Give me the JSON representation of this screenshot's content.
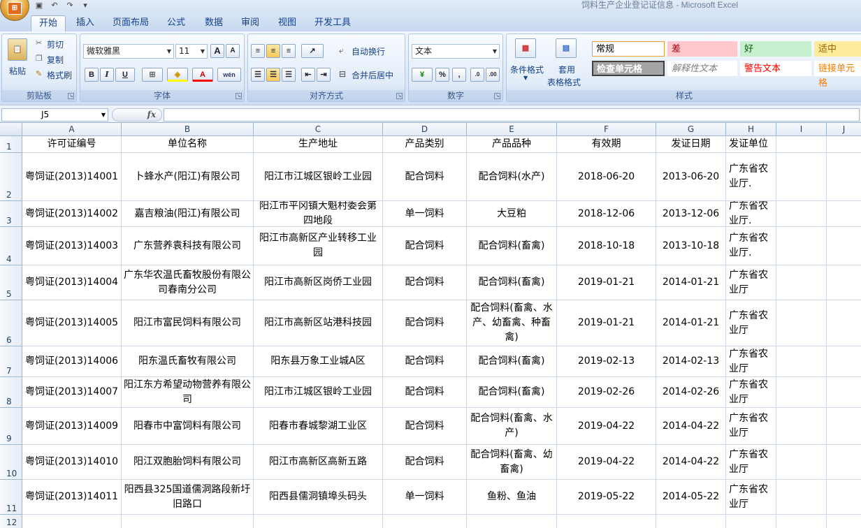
{
  "window": {
    "title": "饲料生产企业登记证信息 - Microsoft Excel"
  },
  "tabs": [
    "开始",
    "插入",
    "页面布局",
    "公式",
    "数据",
    "审阅",
    "视图",
    "开发工具"
  ],
  "ribbon": {
    "clipboard": {
      "paste": "粘贴",
      "cut": "剪切",
      "copy": "复制",
      "format_painter": "格式刷",
      "label": "剪贴板"
    },
    "font": {
      "name": "微软雅黑",
      "size": "11",
      "bold": "B",
      "italic": "I",
      "underline": "U",
      "grow": "A",
      "shrink": "A",
      "color": "A",
      "label": "字体"
    },
    "alignment": {
      "wrap": "自动换行",
      "merge": "合并后居中",
      "label": "对齐方式"
    },
    "number": {
      "format": "文本",
      "percent": "%",
      "comma": ",",
      "label": "数字"
    },
    "styles": {
      "conditional": "条件格式",
      "table_line1": "套用",
      "table_line2": "表格格式",
      "label": "样式",
      "cells": [
        {
          "text": "常规",
          "bg": "#ffffff",
          "color": "#000000",
          "border": "#e8a13a"
        },
        {
          "text": "差",
          "bg": "#ffc7ce",
          "color": "#9c0006",
          "border": "#ffc7ce"
        },
        {
          "text": "好",
          "bg": "#c6efce",
          "color": "#006100",
          "border": "#c6efce"
        },
        {
          "text": "适中",
          "bg": "#ffeb9c",
          "color": "#9c6500",
          "border": "#ffeb9c"
        },
        {
          "text": "检查单元格",
          "bg": "#a5a5a5",
          "color": "#ffffff",
          "border": "#3f3f3f"
        },
        {
          "text": "解释性文本",
          "bg": "#ffffff",
          "color": "#7f7f7f",
          "border": "#ffffff"
        },
        {
          "text": "警告文本",
          "bg": "#ffffff",
          "color": "#ff0000",
          "border": "#ffffff"
        },
        {
          "text": "链接单元格",
          "bg": "#ffffff",
          "color": "#fa7d00",
          "border": "#ffffff"
        }
      ]
    }
  },
  "formula_bar": {
    "name_box": "J5",
    "fx": "fx",
    "content": ""
  },
  "columns": [
    "A",
    "B",
    "C",
    "D",
    "E",
    "F",
    "G",
    "H",
    "I",
    "J"
  ],
  "rows": [
    {
      "n": "1",
      "cells": [
        "许可证编号",
        "单位名称",
        "生产地址",
        "产品类别",
        "产品品种",
        "有效期",
        "发证日期",
        "发证单位",
        "",
        ""
      ]
    },
    {
      "n": "2",
      "cells": [
        "粤饲证(2013)14001",
        "卜蜂水产(阳江)有限公司",
        "阳江市江城区银岭工业园",
        "配合饲料",
        "配合饲料(水产)",
        "2018-06-20",
        "2013-06-20",
        "广东省农业厅.",
        "",
        ""
      ]
    },
    {
      "n": "3",
      "cells": [
        "粤饲证(2013)14002",
        "嘉吉粮油(阳江)有限公司",
        "阳江市平冈镇大魁村委会第四地段",
        "单一饲料",
        "大豆粕",
        "2018-12-06",
        "2013-12-06",
        "广东省农业厅.",
        "",
        ""
      ]
    },
    {
      "n": "4",
      "cells": [
        "粤饲证(2013)14003",
        "广东营养袁科技有限公司",
        "阳江市高新区产业转移工业园",
        "配合饲料",
        "配合饲料(畜禽)",
        "2018-10-18",
        "2013-10-18",
        "广东省农业厅.",
        "",
        ""
      ]
    },
    {
      "n": "5",
      "cells": [
        "粤饲证(2013)14004",
        "广东华农温氏畜牧股份有限公司春南分公司",
        "阳江市高新区岗侨工业园",
        "配合饲料",
        "配合饲料(畜禽)",
        "2019-01-21",
        "2014-01-21",
        "广东省农业厅",
        "",
        ""
      ]
    },
    {
      "n": "6",
      "cells": [
        "粤饲证(2013)14005",
        "阳江市富民饲料有限公司",
        "阳江市高新区站港科技园",
        "配合饲料",
        "配合饲料(畜禽、水产、幼畜禽、种畜禽)",
        "2019-01-21",
        "2014-01-21",
        "广东省农业厅",
        "",
        ""
      ]
    },
    {
      "n": "7",
      "cells": [
        "粤饲证(2013)14006",
        "阳东温氏畜牧有限公司",
        "阳东县万象工业城A区",
        "配合饲料",
        "配合饲料(畜禽)",
        "2019-02-13",
        "2014-02-13",
        "广东省农业厅",
        "",
        ""
      ]
    },
    {
      "n": "8",
      "cells": [
        "粤饲证(2013)14007",
        "阳江东方希望动物营养有限公司",
        "阳江市江城区银岭工业园",
        "配合饲料",
        "配合饲料(畜禽)",
        "2019-02-26",
        "2014-02-26",
        "广东省农业厅",
        "",
        ""
      ]
    },
    {
      "n": "9",
      "cells": [
        "粤饲证(2013)14009",
        "阳春市中富饲料有限公司",
        "阳春市春城黎湖工业区",
        "配合饲料",
        "配合饲料(畜禽、水产)",
        "2019-04-22",
        "2014-04-22",
        "广东省农业厅",
        "",
        ""
      ]
    },
    {
      "n": "10",
      "cells": [
        "粤饲证(2013)14010",
        "阳江双胞胎饲料有限公司",
        "阳江市高新区高新五路",
        "配合饲料",
        "配合饲料(畜禽、幼畜禽)",
        "2019-04-22",
        "2014-04-22",
        "广东省农业厅",
        "",
        ""
      ]
    },
    {
      "n": "11",
      "cells": [
        "粤饲证(2013)14011",
        "阳西县325国道儒洞路段新圩旧路口",
        "阳西县儒洞镇埠头码头",
        "单一饲料",
        "鱼粉、鱼油",
        "2019-05-22",
        "2014-05-22",
        "广东省农业厅",
        "",
        ""
      ]
    },
    {
      "n": "12",
      "cells": [
        "",
        "",
        "",
        "",
        "",
        "",
        "",
        "",
        "",
        ""
      ]
    }
  ]
}
